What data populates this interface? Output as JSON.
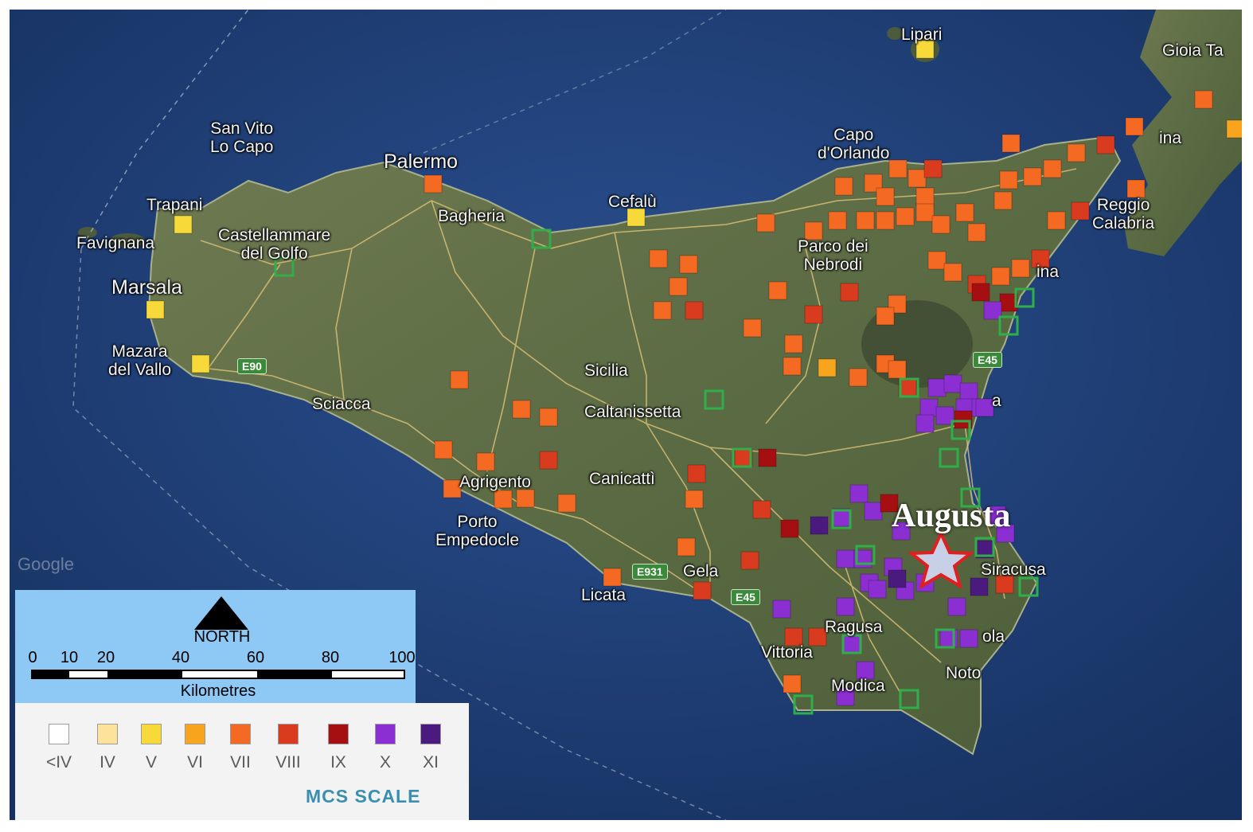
{
  "map": {
    "places": [
      "Lipari",
      "Gioia Ta",
      "San Vito\nLo Capo",
      "Palermo",
      "Capo\nd'Orlando",
      "Trapani",
      "Favignana",
      "Castellammare\ndel Golfo",
      "Bagheria",
      "Cefalù",
      "Parco dei\nNebrodi",
      "Reggio\nCalabria",
      "Marsala",
      "Mazara\ndel Vallo",
      "Sicilia",
      "Sciacca",
      "Caltanissetta",
      "Agrigento",
      "Canicattì",
      "Porto\nEmpedocle",
      "Licata",
      "Gela",
      "Siracusa",
      "Ragusa",
      "Vittoria",
      "Noto",
      "Modica",
      "ina",
      "a",
      "ola",
      "ina",
      "Google"
    ],
    "roads": [
      "E90",
      "E45",
      "E45",
      "E931",
      "E45"
    ],
    "epicenter": {
      "name": "Augusta",
      "marker": "star-icon"
    }
  },
  "scale_box": {
    "north": "NORTH",
    "ticks": [
      "0",
      "10",
      "20",
      "40",
      "60",
      "80",
      "100"
    ],
    "unit": "Kilometres"
  },
  "legend": {
    "title": "MCS SCALE",
    "classes": [
      {
        "label": "<IV",
        "color": "#ffffff"
      },
      {
        "label": "IV",
        "color": "#fde39a"
      },
      {
        "label": "V",
        "color": "#f7d93a"
      },
      {
        "label": "VI",
        "color": "#f8a51d"
      },
      {
        "label": "VII",
        "color": "#f56a22"
      },
      {
        "label": "VIII",
        "color": "#d93b1f"
      },
      {
        "label": "IX",
        "color": "#a60f12"
      },
      {
        "label": "X",
        "color": "#8b2fd3"
      },
      {
        "label": "XI",
        "color": "#4a1a7e"
      }
    ],
    "no_data_outline_color": "#2fae4a"
  }
}
